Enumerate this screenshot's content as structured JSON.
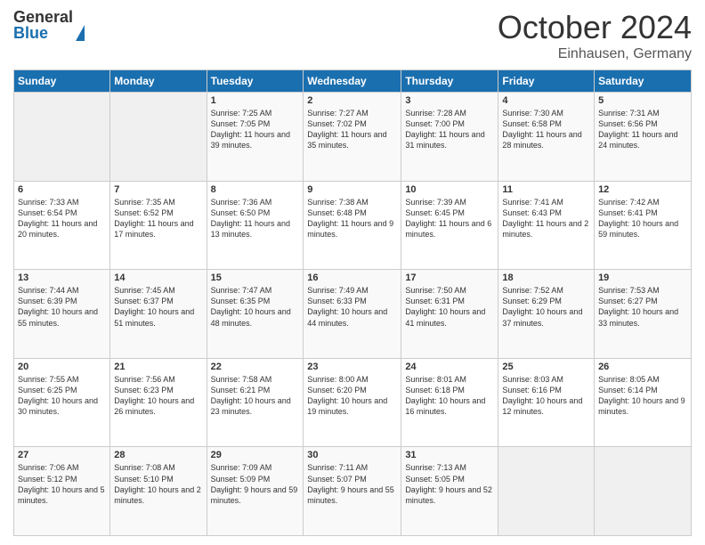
{
  "header": {
    "logo_general": "General",
    "logo_blue": "Blue",
    "month_title": "October 2024",
    "location": "Einhausen, Germany"
  },
  "days_of_week": [
    "Sunday",
    "Monday",
    "Tuesday",
    "Wednesday",
    "Thursday",
    "Friday",
    "Saturday"
  ],
  "weeks": [
    [
      {
        "day": "",
        "sunrise": "",
        "sunset": "",
        "daylight": ""
      },
      {
        "day": "",
        "sunrise": "",
        "sunset": "",
        "daylight": ""
      },
      {
        "day": "1",
        "sunrise": "Sunrise: 7:25 AM",
        "sunset": "Sunset: 7:05 PM",
        "daylight": "Daylight: 11 hours and 39 minutes."
      },
      {
        "day": "2",
        "sunrise": "Sunrise: 7:27 AM",
        "sunset": "Sunset: 7:02 PM",
        "daylight": "Daylight: 11 hours and 35 minutes."
      },
      {
        "day": "3",
        "sunrise": "Sunrise: 7:28 AM",
        "sunset": "Sunset: 7:00 PM",
        "daylight": "Daylight: 11 hours and 31 minutes."
      },
      {
        "day": "4",
        "sunrise": "Sunrise: 7:30 AM",
        "sunset": "Sunset: 6:58 PM",
        "daylight": "Daylight: 11 hours and 28 minutes."
      },
      {
        "day": "5",
        "sunrise": "Sunrise: 7:31 AM",
        "sunset": "Sunset: 6:56 PM",
        "daylight": "Daylight: 11 hours and 24 minutes."
      }
    ],
    [
      {
        "day": "6",
        "sunrise": "Sunrise: 7:33 AM",
        "sunset": "Sunset: 6:54 PM",
        "daylight": "Daylight: 11 hours and 20 minutes."
      },
      {
        "day": "7",
        "sunrise": "Sunrise: 7:35 AM",
        "sunset": "Sunset: 6:52 PM",
        "daylight": "Daylight: 11 hours and 17 minutes."
      },
      {
        "day": "8",
        "sunrise": "Sunrise: 7:36 AM",
        "sunset": "Sunset: 6:50 PM",
        "daylight": "Daylight: 11 hours and 13 minutes."
      },
      {
        "day": "9",
        "sunrise": "Sunrise: 7:38 AM",
        "sunset": "Sunset: 6:48 PM",
        "daylight": "Daylight: 11 hours and 9 minutes."
      },
      {
        "day": "10",
        "sunrise": "Sunrise: 7:39 AM",
        "sunset": "Sunset: 6:45 PM",
        "daylight": "Daylight: 11 hours and 6 minutes."
      },
      {
        "day": "11",
        "sunrise": "Sunrise: 7:41 AM",
        "sunset": "Sunset: 6:43 PM",
        "daylight": "Daylight: 11 hours and 2 minutes."
      },
      {
        "day": "12",
        "sunrise": "Sunrise: 7:42 AM",
        "sunset": "Sunset: 6:41 PM",
        "daylight": "Daylight: 10 hours and 59 minutes."
      }
    ],
    [
      {
        "day": "13",
        "sunrise": "Sunrise: 7:44 AM",
        "sunset": "Sunset: 6:39 PM",
        "daylight": "Daylight: 10 hours and 55 minutes."
      },
      {
        "day": "14",
        "sunrise": "Sunrise: 7:45 AM",
        "sunset": "Sunset: 6:37 PM",
        "daylight": "Daylight: 10 hours and 51 minutes."
      },
      {
        "day": "15",
        "sunrise": "Sunrise: 7:47 AM",
        "sunset": "Sunset: 6:35 PM",
        "daylight": "Daylight: 10 hours and 48 minutes."
      },
      {
        "day": "16",
        "sunrise": "Sunrise: 7:49 AM",
        "sunset": "Sunset: 6:33 PM",
        "daylight": "Daylight: 10 hours and 44 minutes."
      },
      {
        "day": "17",
        "sunrise": "Sunrise: 7:50 AM",
        "sunset": "Sunset: 6:31 PM",
        "daylight": "Daylight: 10 hours and 41 minutes."
      },
      {
        "day": "18",
        "sunrise": "Sunrise: 7:52 AM",
        "sunset": "Sunset: 6:29 PM",
        "daylight": "Daylight: 10 hours and 37 minutes."
      },
      {
        "day": "19",
        "sunrise": "Sunrise: 7:53 AM",
        "sunset": "Sunset: 6:27 PM",
        "daylight": "Daylight: 10 hours and 33 minutes."
      }
    ],
    [
      {
        "day": "20",
        "sunrise": "Sunrise: 7:55 AM",
        "sunset": "Sunset: 6:25 PM",
        "daylight": "Daylight: 10 hours and 30 minutes."
      },
      {
        "day": "21",
        "sunrise": "Sunrise: 7:56 AM",
        "sunset": "Sunset: 6:23 PM",
        "daylight": "Daylight: 10 hours and 26 minutes."
      },
      {
        "day": "22",
        "sunrise": "Sunrise: 7:58 AM",
        "sunset": "Sunset: 6:21 PM",
        "daylight": "Daylight: 10 hours and 23 minutes."
      },
      {
        "day": "23",
        "sunrise": "Sunrise: 8:00 AM",
        "sunset": "Sunset: 6:20 PM",
        "daylight": "Daylight: 10 hours and 19 minutes."
      },
      {
        "day": "24",
        "sunrise": "Sunrise: 8:01 AM",
        "sunset": "Sunset: 6:18 PM",
        "daylight": "Daylight: 10 hours and 16 minutes."
      },
      {
        "day": "25",
        "sunrise": "Sunrise: 8:03 AM",
        "sunset": "Sunset: 6:16 PM",
        "daylight": "Daylight: 10 hours and 12 minutes."
      },
      {
        "day": "26",
        "sunrise": "Sunrise: 8:05 AM",
        "sunset": "Sunset: 6:14 PM",
        "daylight": "Daylight: 10 hours and 9 minutes."
      }
    ],
    [
      {
        "day": "27",
        "sunrise": "Sunrise: 7:06 AM",
        "sunset": "Sunset: 5:12 PM",
        "daylight": "Daylight: 10 hours and 5 minutes."
      },
      {
        "day": "28",
        "sunrise": "Sunrise: 7:08 AM",
        "sunset": "Sunset: 5:10 PM",
        "daylight": "Daylight: 10 hours and 2 minutes."
      },
      {
        "day": "29",
        "sunrise": "Sunrise: 7:09 AM",
        "sunset": "Sunset: 5:09 PM",
        "daylight": "Daylight: 9 hours and 59 minutes."
      },
      {
        "day": "30",
        "sunrise": "Sunrise: 7:11 AM",
        "sunset": "Sunset: 5:07 PM",
        "daylight": "Daylight: 9 hours and 55 minutes."
      },
      {
        "day": "31",
        "sunrise": "Sunrise: 7:13 AM",
        "sunset": "Sunset: 5:05 PM",
        "daylight": "Daylight: 9 hours and 52 minutes."
      },
      {
        "day": "",
        "sunrise": "",
        "sunset": "",
        "daylight": ""
      },
      {
        "day": "",
        "sunrise": "",
        "sunset": "",
        "daylight": ""
      }
    ]
  ]
}
